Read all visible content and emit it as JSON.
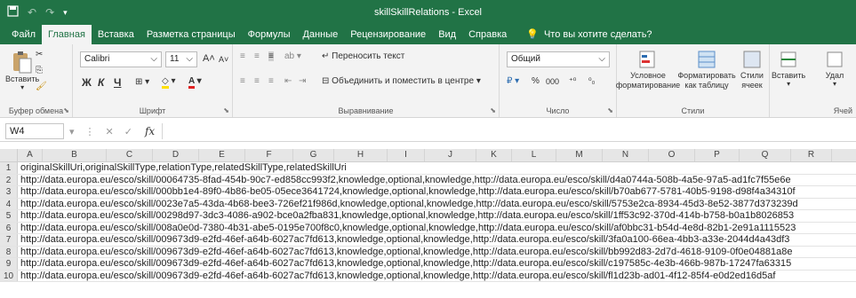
{
  "title": "skillSkillRelations - Excel",
  "tabs": [
    "Файл",
    "Главная",
    "Вставка",
    "Разметка страницы",
    "Формулы",
    "Данные",
    "Рецензирование",
    "Вид",
    "Справка"
  ],
  "active_tab": "Главная",
  "search_hint": "Что вы хотите сделать?",
  "ribbon": {
    "clipboard": {
      "paste": "Вставить",
      "label": "Буфер обмена"
    },
    "font": {
      "name": "Calibri",
      "size": "11",
      "label": "Шрифт",
      "bold": "Ж",
      "italic": "К",
      "underline": "Ч"
    },
    "alignment": {
      "wrap": "Переносить текст",
      "merge": "Объединить и поместить в центре",
      "label": "Выравнивание"
    },
    "number": {
      "format": "Общий",
      "label": "Число",
      "percent": "%",
      "thousands": "000"
    },
    "styles": {
      "conditional": "Условное форматирование",
      "as_table": "Форматировать как таблицу",
      "cell_styles": "Стили ячеек",
      "label": "Стили"
    },
    "cells": {
      "insert": "Вставить",
      "delete": "Удал",
      "label": "Ячей"
    }
  },
  "formula_bar": {
    "name_box": "W4",
    "fx": "fx",
    "value": ""
  },
  "columns": [
    "A",
    "B",
    "C",
    "D",
    "E",
    "F",
    "G",
    "H",
    "I",
    "J",
    "K",
    "L",
    "M",
    "N",
    "O",
    "P",
    "Q",
    "R"
  ],
  "rows": [
    {
      "num": "1",
      "text": "originalSkillUri,originalSkillType,relationType,relatedSkillType,relatedSkillUri"
    },
    {
      "num": "2",
      "text": "http://data.europa.eu/esco/skill/00064735-8fad-454b-90c7-ed858cc993f2,knowledge,optional,knowledge,http://data.europa.eu/esco/skill/d4a0744a-508b-4a5e-97a5-ad1fc7f55e6e"
    },
    {
      "num": "3",
      "text": "http://data.europa.eu/esco/skill/000bb1e4-89f0-4b86-be05-05ece3641724,knowledge,optional,knowledge,http://data.europa.eu/esco/skill/b70ab677-5781-40b5-9198-d98f4a34310f"
    },
    {
      "num": "4",
      "text": "http://data.europa.eu/esco/skill/0023e7a5-43da-4b68-bee3-726ef21f986d,knowledge,optional,knowledge,http://data.europa.eu/esco/skill/5753e2ca-8934-45d3-8e52-3877d373239d"
    },
    {
      "num": "5",
      "text": "http://data.europa.eu/esco/skill/00298d97-3dc3-4086-a902-bce0a2fba831,knowledge,optional,knowledge,http://data.europa.eu/esco/skill/1ff53c92-370d-414b-b758-b0a1b8026853"
    },
    {
      "num": "6",
      "text": "http://data.europa.eu/esco/skill/008a0e0d-7380-4b31-abe5-0195e700f8c0,knowledge,optional,knowledge,http://data.europa.eu/esco/skill/af0bbc31-b54d-4e8d-82b1-2e91a1115523"
    },
    {
      "num": "7",
      "text": "http://data.europa.eu/esco/skill/009673d9-e2fd-46ef-a64b-6027ac7fd613,knowledge,optional,knowledge,http://data.europa.eu/esco/skill/3fa0a100-66ea-4bb3-a33e-2044d4a43df3"
    },
    {
      "num": "8",
      "text": "http://data.europa.eu/esco/skill/009673d9-e2fd-46ef-a64b-6027ac7fd613,knowledge,optional,knowledge,http://data.europa.eu/esco/skill/bb992d83-2d7d-4618-9109-0f0e04881a8e"
    },
    {
      "num": "9",
      "text": "http://data.europa.eu/esco/skill/009673d9-e2fd-46ef-a64b-6027ac7fd613,knowledge,optional,knowledge,http://data.europa.eu/esco/skill/c197585c-4e3b-466b-987b-17247fa63315"
    },
    {
      "num": "10",
      "text": "http://data.europa.eu/esco/skill/009673d9-e2fd-46ef-a64b-6027ac7fd613,knowledge,optional,knowledge,http://data.europa.eu/esco/skill/fl1d23b-ad01-4f12-85f4-e0d2ed16d5af"
    }
  ]
}
